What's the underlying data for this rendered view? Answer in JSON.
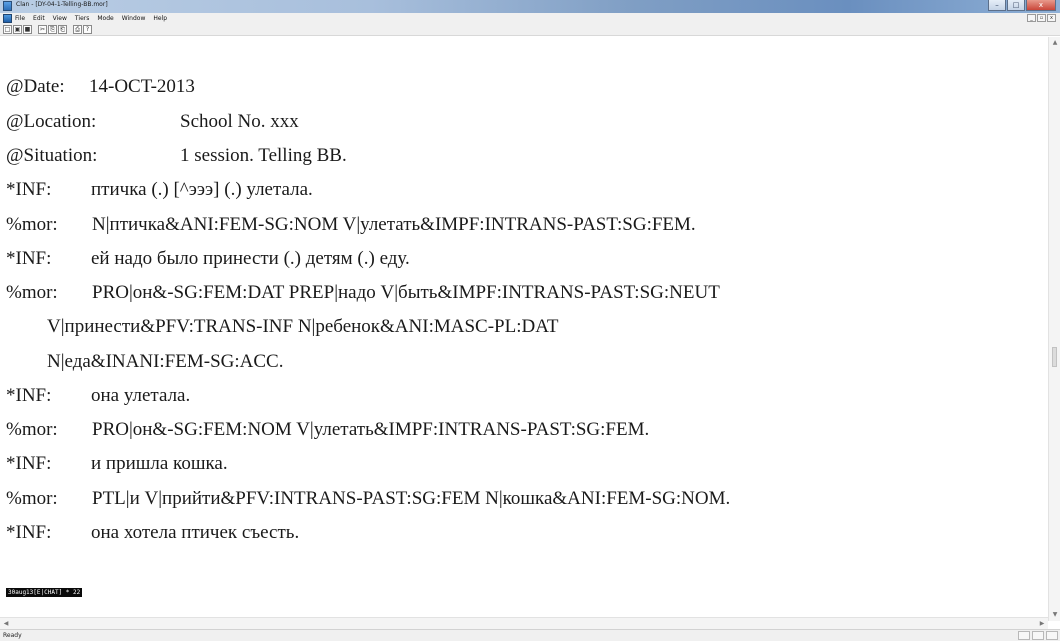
{
  "window": {
    "title": "Clan - [DY-04-1-Telling-BB.mor]",
    "buttons": {
      "minimize": "–",
      "maximize": "□",
      "close": "x"
    }
  },
  "menu": {
    "items": [
      "File",
      "Edit",
      "View",
      "Tiers",
      "Mode",
      "Window",
      "Help"
    ],
    "mdi_buttons": [
      "_",
      "▫",
      "x"
    ]
  },
  "toolbar": {
    "buttons": [
      "new-icon",
      "open-icon",
      "save-icon",
      "cut-icon",
      "copy-icon",
      "paste-icon",
      "print-icon",
      "help-icon"
    ],
    "glyphs": [
      "□",
      "▣",
      "■",
      "✂",
      "⎘",
      "⎗",
      "⎙",
      "?"
    ]
  },
  "transcript": {
    "lines": [
      {
        "tag": "@Date:",
        "text": "14-OCT-2013"
      },
      {
        "tag": "@Location:",
        "text": "School No. xxx"
      },
      {
        "tag": "@Situation:",
        "text": "1 session. Telling BB."
      },
      {
        "tag": "*INF:",
        "text": "птичка (.) [^эээ] (.) улетала."
      },
      {
        "tag": "%mor:",
        "text": "N|птичка&ANI:FEM-SG:NOM V|улетать&IMPF:INTRANS-PAST:SG:FEM."
      },
      {
        "tag": "*INF:",
        "text": "ей надо было принести (.) детям (.) еду."
      },
      {
        "tag": "%mor:",
        "text": "PRO|он&-SG:FEM:DAT PREP|надо V|быть&IMPF:INTRANS-PAST:SG:NEUT"
      },
      {
        "tag": "",
        "text": "V|принести&PFV:TRANS-INF N|ребенок&ANI:MASC-PL:DAT"
      },
      {
        "tag": "",
        "text": "N|еда&INANI:FEM-SG:ACC."
      },
      {
        "tag": "*INF:",
        "text": "она улетала."
      },
      {
        "tag": "%mor:",
        "text": "PRO|он&-SG:FEM:NOM V|улетать&IMPF:INTRANS-PAST:SG:FEM."
      },
      {
        "tag": "*INF:",
        "text": "и пришла кошка."
      },
      {
        "tag": "%mor:",
        "text": "PTL|и V|прийти&PFV:INTRANS-PAST:SG:FEM N|кошка&ANI:FEM-SG:NOM."
      },
      {
        "tag": "*INF:",
        "text": "она хотела птичек съесть."
      }
    ]
  },
  "editor_status": "30aug13[E|CHAT] * 22",
  "statusbar": {
    "text": "Ready"
  }
}
